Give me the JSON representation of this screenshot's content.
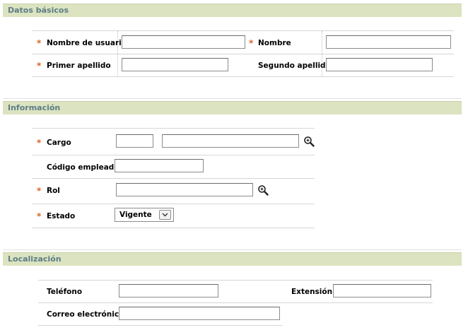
{
  "sections": {
    "basic": {
      "title": "Datos básicos"
    },
    "info": {
      "title": "Información"
    },
    "location": {
      "title": "Localización"
    }
  },
  "required_mark": "*",
  "fields": {
    "username": {
      "label": "Nombre de usuario",
      "value": ""
    },
    "name": {
      "label": "Nombre",
      "value": ""
    },
    "first_surname": {
      "label": "Primer apellido",
      "value": ""
    },
    "second_surname": {
      "label": "Segundo apellido",
      "value": ""
    },
    "position": {
      "label": "Cargo",
      "code": "",
      "value": ""
    },
    "employee_code": {
      "label": "Código empleado",
      "value": ""
    },
    "role": {
      "label": "Rol",
      "value": ""
    },
    "status": {
      "label": "Estado",
      "selected": "Vigente"
    },
    "phone": {
      "label": "Teléfono",
      "value": ""
    },
    "extension": {
      "label": "Extensión",
      "value": ""
    },
    "email": {
      "label": "Correo electrónico",
      "value": ""
    }
  },
  "icons": {
    "lookup": "magnifier-icon",
    "dropdown": "chevron-down-icon"
  },
  "colors": {
    "section_header_bg": "#dbe3c0",
    "section_title": "#5d7d86",
    "required": "#e06020"
  }
}
